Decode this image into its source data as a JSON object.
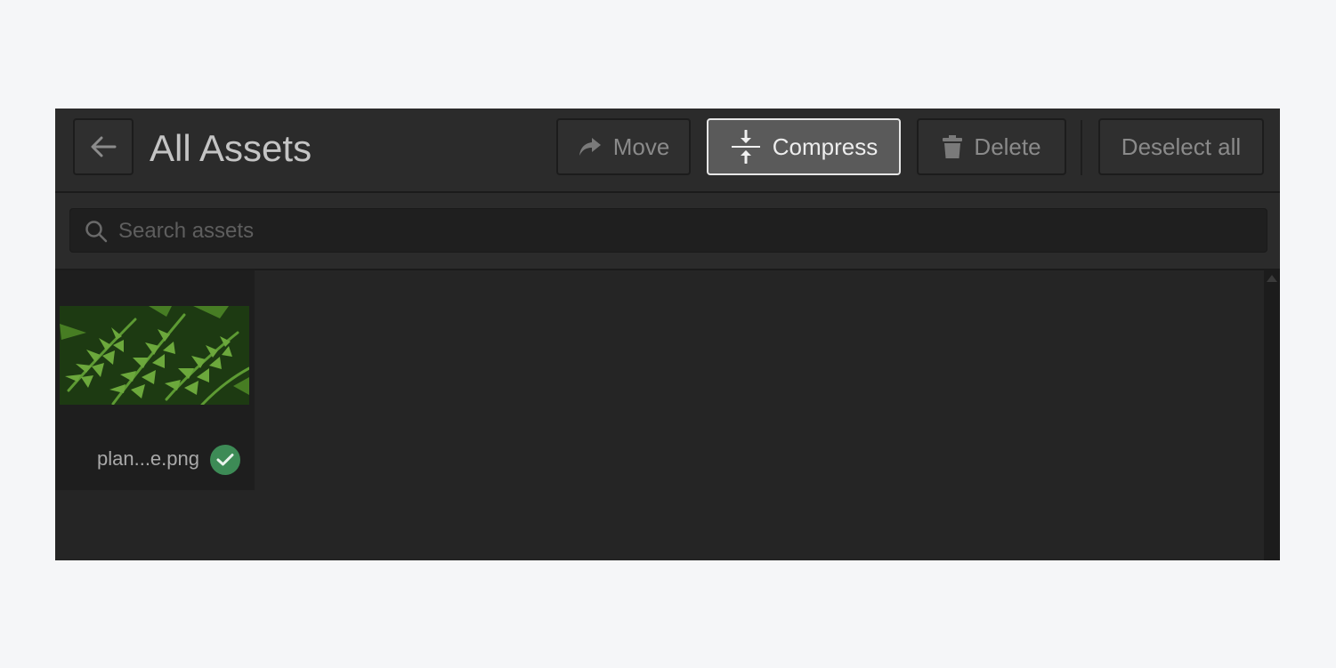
{
  "header": {
    "title": "All Assets",
    "back_icon": "arrow-left-icon"
  },
  "toolbar": {
    "move_label": "Move",
    "move_icon": "share-arrow-icon",
    "compress_label": "Compress",
    "compress_icon": "compress-icon",
    "delete_label": "Delete",
    "delete_icon": "trash-icon",
    "deselect_label": "Deselect all"
  },
  "search": {
    "placeholder": "Search assets",
    "value": "",
    "icon": "search-icon"
  },
  "assets": [
    {
      "name": "plan...e.png",
      "selected": true,
      "thumbnail": "fern leaves image"
    }
  ],
  "colors": {
    "panel_bg": "#262626",
    "compress_active_bg": "#5a5a5a",
    "selected_badge": "#3d8b56",
    "page_bg": "#f5f6f8"
  }
}
